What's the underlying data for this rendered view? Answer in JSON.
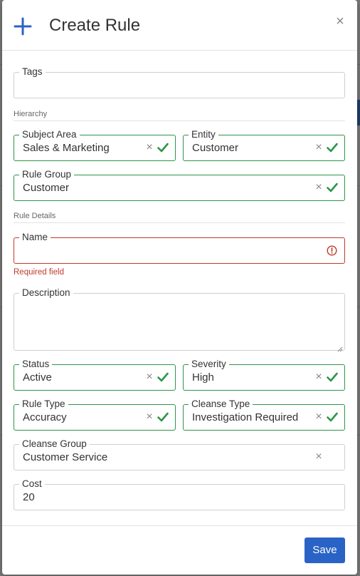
{
  "modal": {
    "title": "Create Rule",
    "close_glyph": "×",
    "plus_icon": "plus-icon"
  },
  "sections": {
    "hierarchy": "Hierarchy",
    "rule_details": "Rule Details"
  },
  "fields": {
    "tags": {
      "label": "Tags",
      "value": ""
    },
    "subject_area": {
      "label": "Subject Area",
      "value": "Sales & Marketing"
    },
    "entity": {
      "label": "Entity",
      "value": "Customer"
    },
    "rule_group": {
      "label": "Rule Group",
      "value": "Customer"
    },
    "name": {
      "label": "Name",
      "value": "",
      "error": "Required field"
    },
    "description": {
      "label": "Description",
      "value": ""
    },
    "status": {
      "label": "Status",
      "value": "Active"
    },
    "severity": {
      "label": "Severity",
      "value": "High"
    },
    "rule_type": {
      "label": "Rule Type",
      "value": "Accuracy"
    },
    "cleanse_type": {
      "label": "Cleanse Type",
      "value": "Investigation Required"
    },
    "cleanse_group": {
      "label": "Cleanse Group",
      "value": "Customer Service"
    },
    "cost": {
      "label": "Cost",
      "value": "20"
    }
  },
  "icons": {
    "clear": "×",
    "valid": "check-icon",
    "error": "error-circle-icon"
  },
  "footer": {
    "save_label": "Save"
  },
  "colors": {
    "accent": "#2a63c6",
    "valid": "#2e9448",
    "error": "#c0392b"
  }
}
